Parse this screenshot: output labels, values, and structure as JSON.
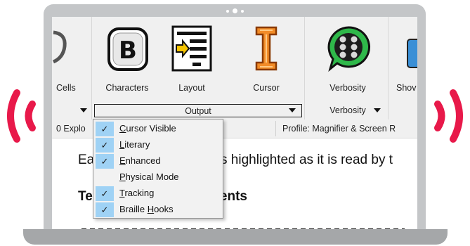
{
  "colors": {
    "accent": "#e8194a",
    "frame": "#c4c6c8",
    "menu_check_bg": "#9fd2f5"
  },
  "ribbon": {
    "cut_item_label": "Cells",
    "cut_item_right_label": "Shov",
    "items": [
      {
        "label": "Characters",
        "icon": "braille-b-icon"
      },
      {
        "label": "Layout",
        "icon": "layout-arrow-icon"
      },
      {
        "label": "Cursor",
        "icon": "i-beam-cursor-icon"
      },
      {
        "label": "Verbosity",
        "icon": "braille-speech-bubble-icon"
      }
    ],
    "group_output_label": "Output",
    "group_verbosity_label": "Verbosity"
  },
  "statusbar": {
    "left_text": "0 Explo",
    "profile_text": "Profile: Magnifier & Screen R"
  },
  "document": {
    "line1_left": "Ea",
    "line1_right": "s highlighted as it is read by t",
    "heading_left": "Te",
    "heading_right": "ments"
  },
  "output_menu": {
    "items": [
      {
        "prefix": "",
        "mnemonic": "C",
        "rest": "ursor Visible",
        "checked": true
      },
      {
        "prefix": "",
        "mnemonic": "L",
        "rest": "iterary",
        "checked": true
      },
      {
        "prefix": "",
        "mnemonic": "E",
        "rest": "nhanced",
        "checked": true
      },
      {
        "prefix": "",
        "mnemonic": "P",
        "rest": "hysical Mode",
        "checked": false
      },
      {
        "prefix": "",
        "mnemonic": "T",
        "rest": "racking",
        "checked": true
      },
      {
        "prefix": "Braille ",
        "mnemonic": "H",
        "rest": "ooks",
        "checked": true
      }
    ]
  }
}
